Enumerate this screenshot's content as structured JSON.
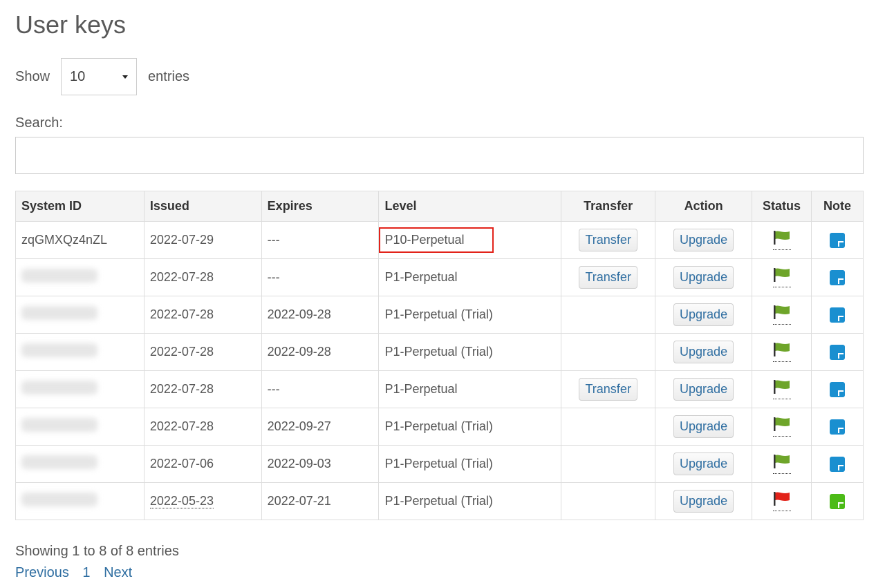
{
  "page": {
    "title": "User keys"
  },
  "length": {
    "show_label": "Show",
    "value": "10",
    "entries_label": "entries"
  },
  "search": {
    "label": "Search:",
    "value": "",
    "placeholder": ""
  },
  "table": {
    "columns": [
      "System ID",
      "Issued",
      "Expires",
      "Level",
      "Transfer",
      "Action",
      "Status",
      "Note"
    ],
    "rows": [
      {
        "system_id": "zqGMXQz4nZL",
        "blurred": false,
        "issued": "2022-07-29",
        "issued_dotted": false,
        "expires": "---",
        "level": "P10-Perpetual",
        "highlight": true,
        "transfer": "Transfer",
        "action": "Upgrade",
        "status_color": "#6ea52a",
        "note_color": "#1a8fd0"
      },
      {
        "system_id": "",
        "blurred": true,
        "issued": "2022-07-28",
        "issued_dotted": false,
        "expires": "---",
        "level": "P1-Perpetual",
        "highlight": false,
        "transfer": "Transfer",
        "action": "Upgrade",
        "status_color": "#6ea52a",
        "note_color": "#1a8fd0"
      },
      {
        "system_id": "",
        "blurred": true,
        "issued": "2022-07-28",
        "issued_dotted": false,
        "expires": "2022-09-28",
        "level": "P1-Perpetual (Trial)",
        "highlight": false,
        "transfer": "",
        "action": "Upgrade",
        "status_color": "#6ea52a",
        "note_color": "#1a8fd0"
      },
      {
        "system_id": "",
        "blurred": true,
        "issued": "2022-07-28",
        "issued_dotted": false,
        "expires": "2022-09-28",
        "level": "P1-Perpetual (Trial)",
        "highlight": false,
        "transfer": "",
        "action": "Upgrade",
        "status_color": "#6ea52a",
        "note_color": "#1a8fd0"
      },
      {
        "system_id": "",
        "blurred": true,
        "issued": "2022-07-28",
        "issued_dotted": false,
        "expires": "---",
        "level": "P1-Perpetual",
        "highlight": false,
        "transfer": "Transfer",
        "action": "Upgrade",
        "status_color": "#6ea52a",
        "note_color": "#1a8fd0"
      },
      {
        "system_id": "",
        "blurred": true,
        "issued": "2022-07-28",
        "issued_dotted": false,
        "expires": "2022-09-27",
        "level": "P1-Perpetual (Trial)",
        "highlight": false,
        "transfer": "",
        "action": "Upgrade",
        "status_color": "#6ea52a",
        "note_color": "#1a8fd0"
      },
      {
        "system_id": "",
        "blurred": true,
        "issued": "2022-07-06",
        "issued_dotted": false,
        "expires": "2022-09-03",
        "level": "P1-Perpetual (Trial)",
        "highlight": false,
        "transfer": "",
        "action": "Upgrade",
        "status_color": "#6ea52a",
        "note_color": "#1a8fd0"
      },
      {
        "system_id": "",
        "blurred": true,
        "issued": "2022-05-23",
        "issued_dotted": true,
        "expires": "2022-07-21",
        "level": "P1-Perpetual (Trial)",
        "highlight": false,
        "transfer": "",
        "action": "Upgrade",
        "status_color": "#e2231a",
        "note_color": "#4cbb17"
      }
    ]
  },
  "info": {
    "text": "Showing 1 to 8 of 8 entries"
  },
  "pagination": {
    "previous": "Previous",
    "page": "1",
    "next": "Next"
  },
  "icons": {
    "status": "flag-icon",
    "note": "note-icon",
    "select": "chevron-down-icon"
  },
  "colors": {
    "link": "#2f6ea1",
    "highlight": "#e2231a"
  }
}
